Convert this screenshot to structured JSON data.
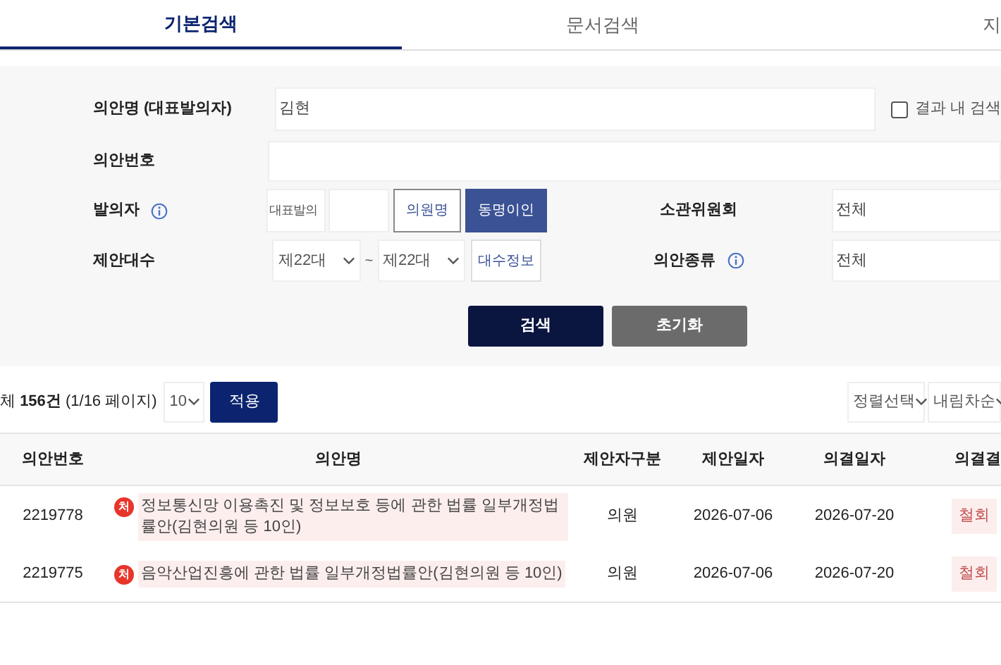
{
  "tabs": [
    {
      "label": "기본검색",
      "selected": true
    },
    {
      "label": "문서검색",
      "selected": false
    },
    {
      "label": "지",
      "selected": false
    }
  ],
  "search_form": {
    "bill_name": {
      "label": "의안명 (대표발의자)",
      "value": "김현"
    },
    "search_within": {
      "label": "결과 내 검색",
      "checked": false
    },
    "bill_number": {
      "label": "의안번호"
    },
    "proposer": {
      "label": "발의자",
      "type_select": "대표발의",
      "name_buttons": [
        {
          "label": "의원명",
          "selected": false
        },
        {
          "label": "동명이인",
          "selected": true
        }
      ]
    },
    "committee": {
      "label": "소관위원회",
      "value": "전체"
    },
    "assembly": {
      "label": "제안대수",
      "from": "제22대",
      "separator": "~",
      "to": "제22대",
      "info_button": "대수정보"
    },
    "bill_type": {
      "label": "의안종류",
      "value": "전체"
    },
    "buttons": [
      {
        "label": "검색",
        "kind": "primary"
      },
      {
        "label": "초기화",
        "kind": "secondary"
      }
    ]
  },
  "results_bar": {
    "summary": "체 **156건** (1/16 페이지)",
    "page_size": "10",
    "apply": "적용",
    "sort": "정렬선택",
    "order": "내림차순"
  },
  "table": {
    "columns": [
      "의안번호",
      "의안명",
      "제안자구분",
      "제안일자",
      "의결일자",
      "의결결"
    ],
    "rows": [
      {
        "number": "2219778",
        "badge": "처",
        "title": "정보통신망 이용촉진 및 정보보호 등에 관한 법률 일부개정법률안(김현의원 등 10인)",
        "proposer_type": "의원",
        "proposed": "2026-07-06",
        "decided": "2026-07-20",
        "result": "철회"
      },
      {
        "number": "2219775",
        "badge": "처",
        "title": "음악산업진흥에 관한 법률 일부개정법률안(김현의원 등 10인)",
        "proposer_type": "의원",
        "proposed": "2026-07-06",
        "decided": "2026-07-20",
        "result": "철회"
      }
    ]
  }
}
